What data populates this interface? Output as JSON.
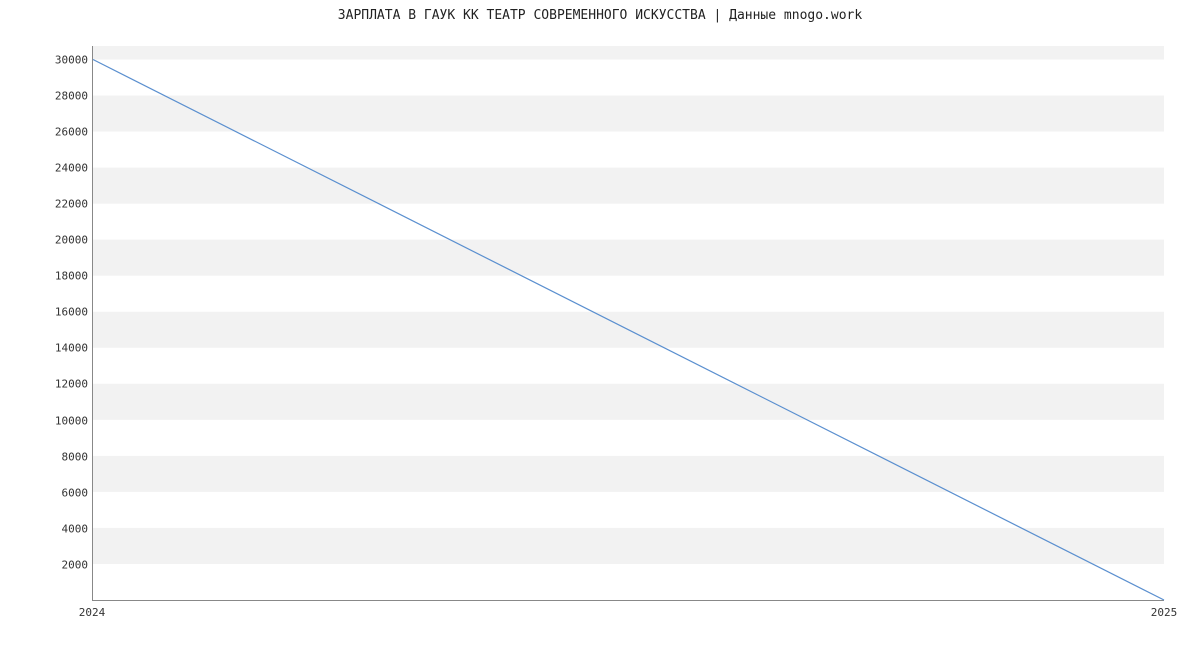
{
  "chart_data": {
    "type": "line",
    "title": "ЗАРПЛАТА В ГАУК КК ТЕАТР СОВРЕМЕННОГО ИСКУССТВА | Данные mnogo.work",
    "xlabel": "",
    "ylabel": "",
    "x": [
      2024,
      2025
    ],
    "values": [
      30000,
      0
    ],
    "x_ticks": [
      2024,
      2025
    ],
    "y_ticks": [
      2000,
      4000,
      6000,
      8000,
      10000,
      12000,
      14000,
      16000,
      18000,
      20000,
      22000,
      24000,
      26000,
      28000,
      30000
    ],
    "xlim": [
      2024,
      2025
    ],
    "ylim": [
      0,
      30750
    ]
  }
}
